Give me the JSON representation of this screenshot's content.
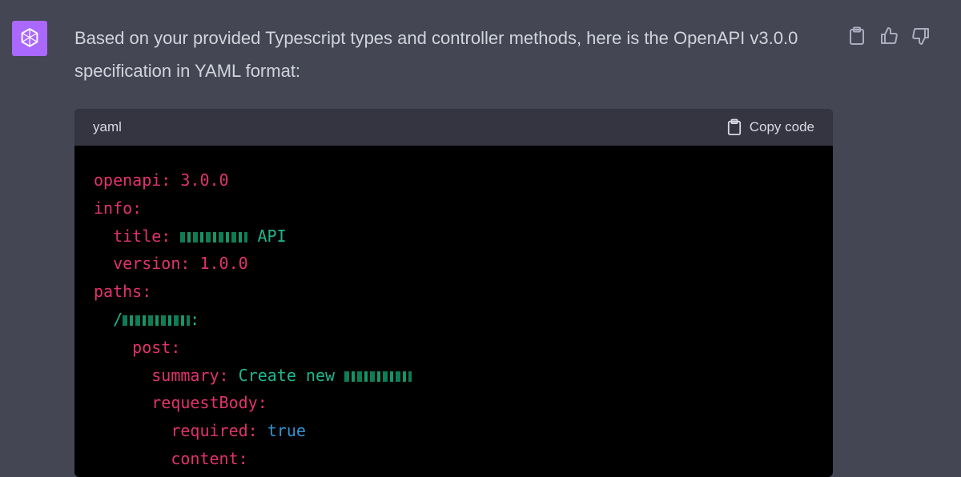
{
  "message": {
    "text": "Based on your provided Typescript types and controller methods, here is the OpenAPI v3.0.0 specification in YAML format:"
  },
  "actions": {
    "copy": "clipboard-icon",
    "like": "thumbs-up-icon",
    "dislike": "thumbs-down-icon"
  },
  "code_block": {
    "language": "yaml",
    "copy_label": "Copy code",
    "lines": {
      "l1_key": "openapi:",
      "l1_val": "3.0.0",
      "l2_key": "info:",
      "l3_key": "title:",
      "l3_val_suffix": "API",
      "l4_key": "version:",
      "l4_val": "1.0.0",
      "l5_key": "paths:",
      "l6_prefix": "/",
      "l6_suffix": ":",
      "l7_key": "post:",
      "l8_key": "summary:",
      "l8_val": "Create new",
      "l9_key": "requestBody:",
      "l10_key": "required:",
      "l10_val": "true",
      "l11_key": "content:"
    }
  },
  "colors": {
    "background": "#444654",
    "avatar": "#ab68ff",
    "code_background": "#000000",
    "code_header": "#343541",
    "key": "#e1336b",
    "string": "#1cb78e",
    "boolean": "#2e95d3"
  }
}
